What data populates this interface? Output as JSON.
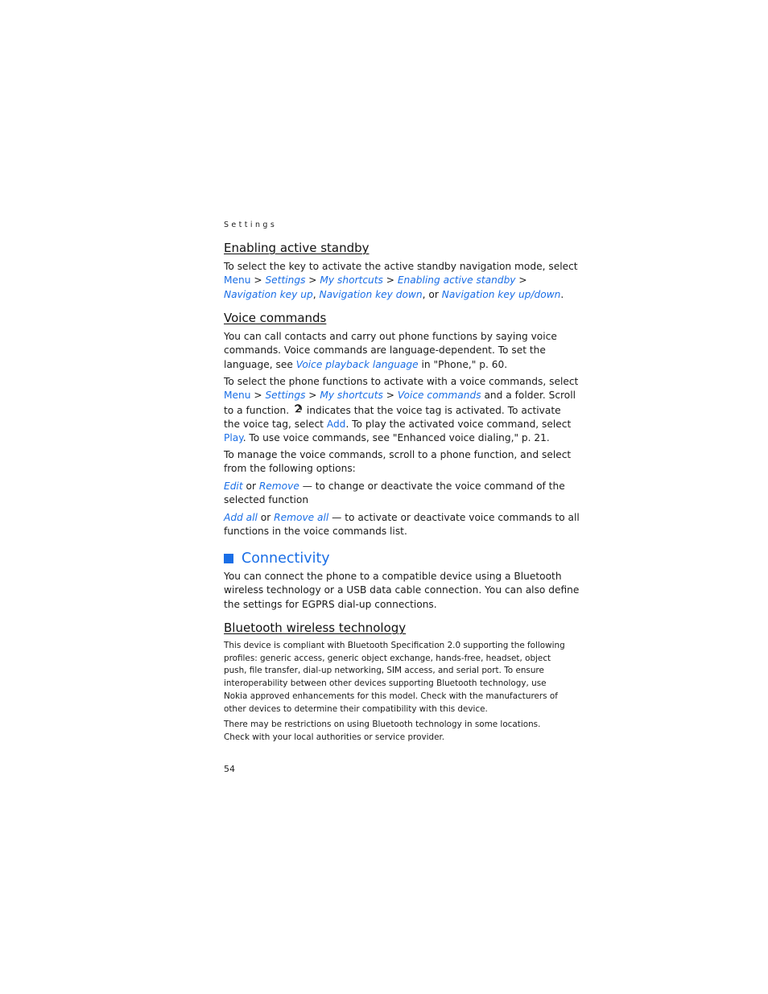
{
  "running_head": "Settings",
  "page_number": "54",
  "sections": {
    "active_standby": {
      "heading": "Enabling active standby",
      "intro": "To select the key to activate the active standby navigation mode, select",
      "path": [
        "Menu",
        "Settings",
        "My shortcuts",
        "Enabling active standby"
      ],
      "sep": " > ",
      "options": [
        "Navigation key up",
        "Navigation key down",
        "Navigation key up/down"
      ],
      "comma": ", ",
      "or": ", or ",
      "end": "."
    },
    "voice_commands": {
      "heading": "Voice commands",
      "p1_line1": "You can call contacts and carry out phone functions by saying voice",
      "p1_line2": "commands. Voice commands are language-dependent. To set the",
      "p1_line3_pre": "language, see ",
      "p1_link": "Voice playback language",
      "p1_line3_post": " in \"Phone,\" p. 60.",
      "p2_line1": "To select the phone functions to activate with a voice commands, select",
      "p2_path": [
        "Menu",
        "Settings",
        "My shortcuts",
        "Voice commands"
      ],
      "p2_line2_post": " and a folder. Scroll",
      "p2_line3_pre": "to a function. ",
      "voice_tag_icon": "voice-tag-icon",
      "p2_line3_post": " indicates that the voice tag is activated. To activate",
      "p2_line4_pre": "the voice tag, select ",
      "add": "Add",
      "p2_line4_post": ". To play the activated voice command, select",
      "play": "Play",
      "p2_line5_post": ". To use voice commands, see \"Enhanced voice dialing,\" p. 21.",
      "p3_line1": "To manage the voice commands, scroll to a phone function, and select",
      "p3_line2": "from the following options:",
      "opt1_a": "Edit",
      "opt1_or": " or ",
      "opt1_b": "Remove",
      "opt1_desc1": " — to change or deactivate the voice command of the",
      "opt1_desc2": "selected function",
      "opt2_a": "Add all",
      "opt2_or": " or ",
      "opt2_b": "Remove all",
      "opt2_desc1": " — to activate or deactivate voice commands to all",
      "opt2_desc2": "functions in the voice commands list."
    },
    "connectivity": {
      "heading": "Connectivity",
      "line1": "You can connect the phone to a compatible device using a Bluetooth",
      "line2": "wireless technology or a USB data cable connection. You can also define",
      "line3": "the settings for EGPRS dial-up connections."
    },
    "bluetooth": {
      "heading": "Bluetooth wireless technology",
      "p1": [
        "This device is compliant with Bluetooth Specification 2.0 supporting the following",
        "profiles: generic access, generic object exchange, hands-free, headset, object",
        "push, file transfer, dial-up networking, SIM access, and serial port. To ensure",
        "interoperability between other devices supporting Bluetooth technology, use",
        "Nokia approved enhancements for this model. Check with the manufacturers of",
        "other devices to determine their compatibility with this device."
      ],
      "p2": [
        "There may be restrictions on using Bluetooth technology in some locations.",
        "Check with your local authorities or service provider."
      ]
    }
  },
  "colors": {
    "link": "#1a6ee6",
    "text": "#1a1a1a"
  }
}
